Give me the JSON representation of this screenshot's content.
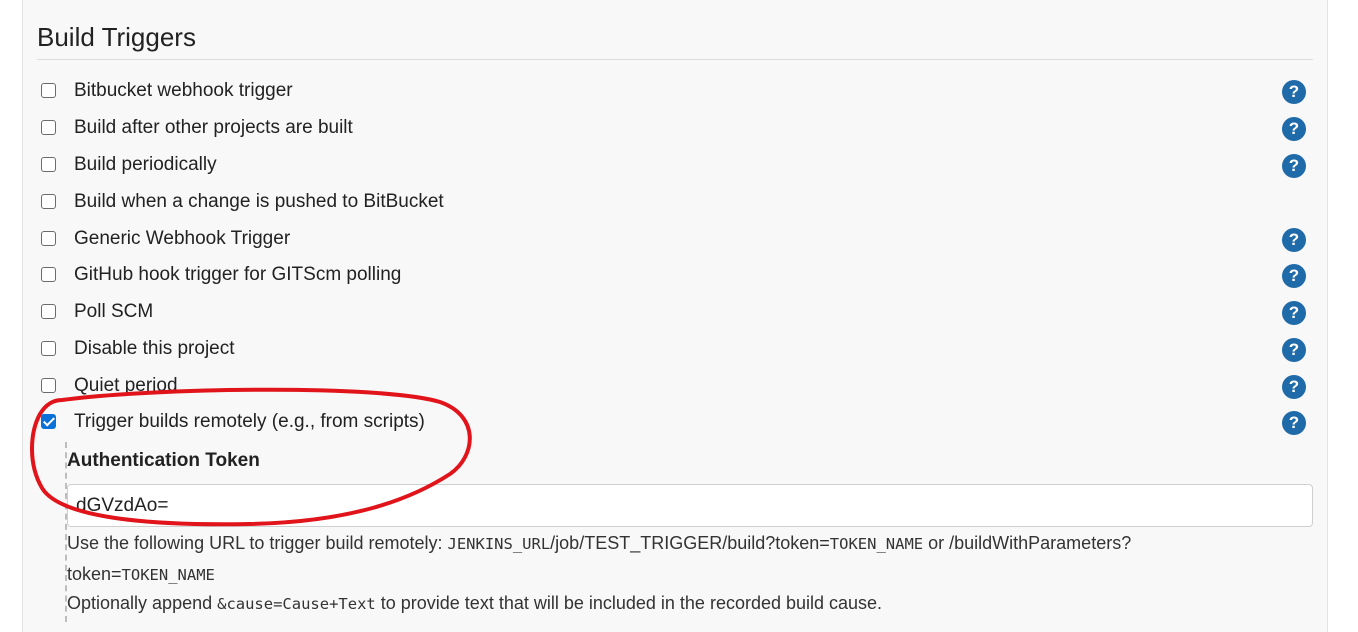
{
  "section": {
    "title": "Build Triggers"
  },
  "triggers": [
    {
      "label": "Bitbucket webhook trigger",
      "checked": false,
      "has_help": true
    },
    {
      "label": "Build after other projects are built",
      "checked": false,
      "has_help": true
    },
    {
      "label": "Build periodically",
      "checked": false,
      "has_help": true
    },
    {
      "label": "Build when a change is pushed to BitBucket",
      "checked": false,
      "has_help": false
    },
    {
      "label": "Generic Webhook Trigger",
      "checked": false,
      "has_help": true
    },
    {
      "label": "GitHub hook trigger for GITScm polling",
      "checked": false,
      "has_help": true
    },
    {
      "label": "Poll SCM",
      "checked": false,
      "has_help": true
    },
    {
      "label": "Disable this project",
      "checked": false,
      "has_help": true
    },
    {
      "label": "Quiet period",
      "checked": false,
      "has_help": true
    },
    {
      "label": "Trigger builds remotely (e.g., from scripts)",
      "checked": true,
      "has_help": true
    }
  ],
  "help_glyph": "?",
  "auth_token": {
    "label": "Authentication Token",
    "value": "dGVzdAo="
  },
  "description": {
    "line1_text": "Use the following URL to trigger build remotely: ",
    "line1_url": "JENKINS_URL",
    "line1_path": "/job/TEST_TRIGGER/build?token=",
    "line1_token": "TOKEN_NAME",
    "line1_or": " or /buildWithParameters?",
    "line2_prefix": "token=",
    "line2_token": "TOKEN_NAME",
    "line3_before": "Optionally append ",
    "line3_code": "&cause=Cause+Text",
    "line3_after": " to provide text that will be included in the recorded build cause."
  },
  "colors": {
    "help_icon": "#1f6aa8",
    "checkbox_checked": "#0b70d7",
    "annotation_circle": "#e0141a"
  }
}
